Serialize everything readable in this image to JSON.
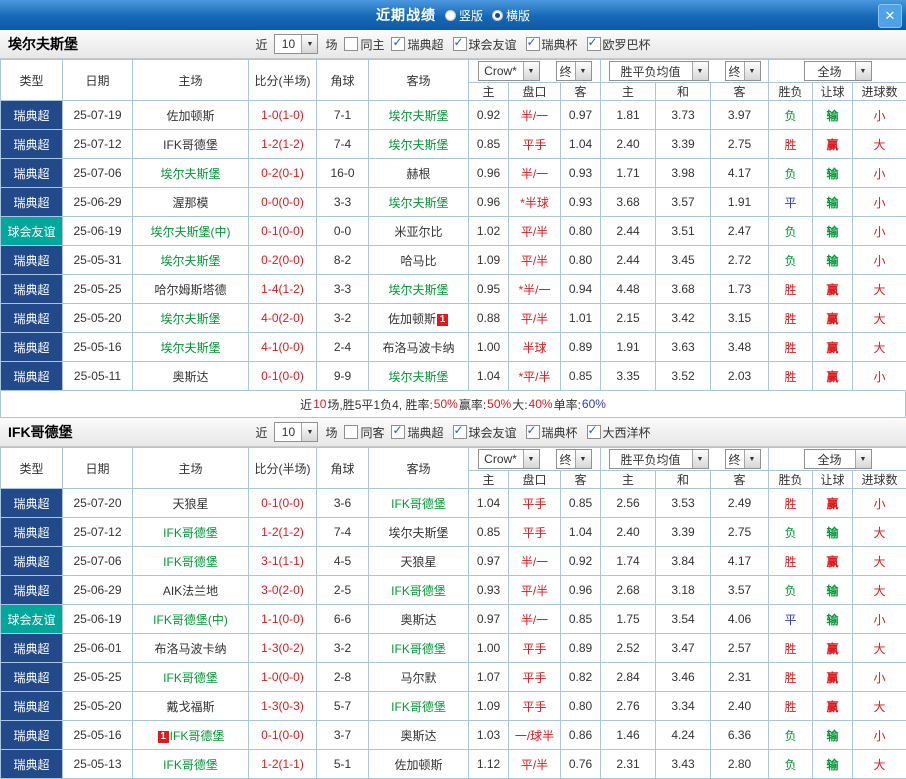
{
  "colors": {
    "red": "#e1191c",
    "green": "#009933",
    "blue": "#2f39c9",
    "navy": "#22498a",
    "teal": "#00a79b"
  },
  "top_bar": {
    "title": "近期战绩",
    "vertical_label": "竖版",
    "horizontal_label": "横版",
    "selected_layout": "横版",
    "close_label": "✕"
  },
  "table_header": {
    "type": "类型",
    "date": "日期",
    "home": "主场",
    "score": "比分(半场)",
    "corner": "角球",
    "away": "客场",
    "sub": [
      "主",
      "盘口",
      "客",
      "主",
      "和",
      "客",
      "胜负",
      "让球",
      "进球数"
    ],
    "dropdown_company": "Crow*",
    "dropdown_final1": "终",
    "dropdown_europe": "胜平负均值",
    "dropdown_final2": "终",
    "dropdown_scope": "全场"
  },
  "sections": [
    {
      "team": "埃尔夫斯堡",
      "filter": {
        "near": "近",
        "count": "10",
        "games": "场",
        "same": "同主",
        "same_checked": false,
        "leagues": [
          {
            "label": "瑞典超",
            "checked": true
          },
          {
            "label": "球会友谊",
            "checked": true
          },
          {
            "label": "瑞典杯",
            "checked": true
          },
          {
            "label": "欧罗巴杯",
            "checked": true
          }
        ]
      },
      "rows": [
        {
          "type": "瑞典超",
          "friendly": false,
          "date": "25-07-19",
          "home": "佐加顿斯",
          "home_focus": false,
          "score": "1-0(1-0)",
          "corner": "7-1",
          "away": "埃尔夫斯堡",
          "away_focus": true,
          "ah_home": "0.92",
          "ah_line": "半/一",
          "ah_away": "0.97",
          "eu_home": "1.81",
          "eu_draw": "3.73",
          "eu_away": "3.97",
          "result": "负",
          "let_ball": "输",
          "goal": "小"
        },
        {
          "type": "瑞典超",
          "friendly": false,
          "date": "25-07-12",
          "home": "IFK哥德堡",
          "home_focus": false,
          "score": "1-2(1-2)",
          "corner": "7-4",
          "away": "埃尔夫斯堡",
          "away_focus": true,
          "ah_home": "0.85",
          "ah_line": "平手",
          "ah_away": "1.04",
          "eu_home": "2.40",
          "eu_draw": "3.39",
          "eu_away": "2.75",
          "result": "胜",
          "let_ball": "赢",
          "goal": "大"
        },
        {
          "type": "瑞典超",
          "friendly": false,
          "date": "25-07-06",
          "home": "埃尔夫斯堡",
          "home_focus": true,
          "score": "0-2(0-1)",
          "corner": "16-0",
          "away": "赫根",
          "away_focus": false,
          "ah_home": "0.96",
          "ah_line": "半/一",
          "ah_away": "0.93",
          "eu_home": "1.71",
          "eu_draw": "3.98",
          "eu_away": "4.17",
          "result": "负",
          "let_ball": "输",
          "goal": "小"
        },
        {
          "type": "瑞典超",
          "friendly": false,
          "date": "25-06-29",
          "home": "渥那模",
          "home_focus": false,
          "score": "0-0(0-0)",
          "corner": "3-3",
          "away": "埃尔夫斯堡",
          "away_focus": true,
          "ah_home": "0.96",
          "ah_line": "*半球",
          "ah_away": "0.93",
          "eu_home": "3.68",
          "eu_draw": "3.57",
          "eu_away": "1.91",
          "result": "平",
          "let_ball": "输",
          "goal": "小"
        },
        {
          "type": "球会友谊",
          "friendly": true,
          "date": "25-06-19",
          "home": "埃尔夫斯堡(中)",
          "home_focus": true,
          "score": "0-1(0-0)",
          "corner": "0-0",
          "away": "米亚尔比",
          "away_focus": false,
          "ah_home": "1.02",
          "ah_line": "平/半",
          "ah_away": "0.80",
          "eu_home": "2.44",
          "eu_draw": "3.51",
          "eu_away": "2.47",
          "result": "负",
          "let_ball": "输",
          "goal": "小"
        },
        {
          "type": "瑞典超",
          "friendly": false,
          "date": "25-05-31",
          "home": "埃尔夫斯堡",
          "home_focus": true,
          "score": "0-2(0-0)",
          "corner": "8-2",
          "away": "哈马比",
          "away_focus": false,
          "ah_home": "1.09",
          "ah_line": "平/半",
          "ah_away": "0.80",
          "eu_home": "2.44",
          "eu_draw": "3.45",
          "eu_away": "2.72",
          "result": "负",
          "let_ball": "输",
          "goal": "小"
        },
        {
          "type": "瑞典超",
          "friendly": false,
          "date": "25-05-25",
          "home": "哈尔姆斯塔德",
          "home_focus": false,
          "score": "1-4(1-2)",
          "corner": "3-3",
          "away": "埃尔夫斯堡",
          "away_focus": true,
          "ah_home": "0.95",
          "ah_line": "*半/一",
          "ah_away": "0.94",
          "eu_home": "4.48",
          "eu_draw": "3.68",
          "eu_away": "1.73",
          "result": "胜",
          "let_ball": "赢",
          "goal": "大"
        },
        {
          "type": "瑞典超",
          "friendly": false,
          "date": "25-05-20",
          "home": "埃尔夫斯堡",
          "home_focus": true,
          "score": "4-0(2-0)",
          "corner": "3-2",
          "away": "佐加顿斯",
          "away_focus": false,
          "away_card": "1",
          "ah_home": "0.88",
          "ah_line": "平/半",
          "ah_away": "1.01",
          "eu_home": "2.15",
          "eu_draw": "3.42",
          "eu_away": "3.15",
          "result": "胜",
          "let_ball": "赢",
          "goal": "大"
        },
        {
          "type": "瑞典超",
          "friendly": false,
          "date": "25-05-16",
          "home": "埃尔夫斯堡",
          "home_focus": true,
          "score": "4-1(0-0)",
          "corner": "2-4",
          "away": "布洛马波卡纳",
          "away_focus": false,
          "ah_home": "1.00",
          "ah_line": "半球",
          "ah_away": "0.89",
          "eu_home": "1.91",
          "eu_draw": "3.63",
          "eu_away": "3.48",
          "result": "胜",
          "let_ball": "赢",
          "goal": "大"
        },
        {
          "type": "瑞典超",
          "friendly": false,
          "date": "25-05-11",
          "home": "奥斯达",
          "home_focus": false,
          "score": "0-1(0-0)",
          "corner": "9-9",
          "away": "埃尔夫斯堡",
          "away_focus": true,
          "ah_home": "1.04",
          "ah_line": "*平/半",
          "ah_away": "0.85",
          "eu_home": "3.35",
          "eu_draw": "3.52",
          "eu_away": "2.03",
          "result": "胜",
          "let_ball": "赢",
          "goal": "小"
        }
      ],
      "summary": [
        {
          "t": "近"
        },
        {
          "t": "10",
          "c": "red"
        },
        {
          "t": "场,胜5平1负4, 胜率:"
        },
        {
          "t": "50%",
          "c": "red"
        },
        {
          "t": " 赢率:"
        },
        {
          "t": "50%",
          "c": "red"
        },
        {
          "t": " 大:"
        },
        {
          "t": "40%",
          "c": "red"
        },
        {
          "t": " 单率:"
        },
        {
          "t": "60%",
          "c": "blue"
        }
      ]
    },
    {
      "team": "IFK哥德堡",
      "filter": {
        "near": "近",
        "count": "10",
        "games": "场",
        "same": "同客",
        "same_checked": false,
        "leagues": [
          {
            "label": "瑞典超",
            "checked": true
          },
          {
            "label": "球会友谊",
            "checked": true
          },
          {
            "label": "瑞典杯",
            "checked": true
          },
          {
            "label": "大西洋杯",
            "checked": true
          }
        ]
      },
      "rows": [
        {
          "type": "瑞典超",
          "friendly": false,
          "date": "25-07-20",
          "home": "天狼星",
          "home_focus": false,
          "score": "0-1(0-0)",
          "corner": "3-6",
          "away": "IFK哥德堡",
          "away_focus": true,
          "ah_home": "1.04",
          "ah_line": "平手",
          "ah_away": "0.85",
          "eu_home": "2.56",
          "eu_draw": "3.53",
          "eu_away": "2.49",
          "result": "胜",
          "let_ball": "赢",
          "goal": "小"
        },
        {
          "type": "瑞典超",
          "friendly": false,
          "date": "25-07-12",
          "home": "IFK哥德堡",
          "home_focus": true,
          "score": "1-2(1-2)",
          "corner": "7-4",
          "away": "埃尔夫斯堡",
          "away_focus": false,
          "ah_home": "0.85",
          "ah_line": "平手",
          "ah_away": "1.04",
          "eu_home": "2.40",
          "eu_draw": "3.39",
          "eu_away": "2.75",
          "result": "负",
          "let_ball": "输",
          "goal": "大"
        },
        {
          "type": "瑞典超",
          "friendly": false,
          "date": "25-07-06",
          "home": "IFK哥德堡",
          "home_focus": true,
          "score": "3-1(1-1)",
          "corner": "4-5",
          "away": "天狼星",
          "away_focus": false,
          "ah_home": "0.97",
          "ah_line": "半/一",
          "ah_away": "0.92",
          "eu_home": "1.74",
          "eu_draw": "3.84",
          "eu_away": "4.17",
          "result": "胜",
          "let_ball": "赢",
          "goal": "大"
        },
        {
          "type": "瑞典超",
          "friendly": false,
          "date": "25-06-29",
          "home": "AIK法兰地",
          "home_focus": false,
          "score": "3-0(2-0)",
          "corner": "2-5",
          "away": "IFK哥德堡",
          "away_focus": true,
          "ah_home": "0.93",
          "ah_line": "平/半",
          "ah_away": "0.96",
          "eu_home": "2.68",
          "eu_draw": "3.18",
          "eu_away": "3.57",
          "result": "负",
          "let_ball": "输",
          "goal": "大"
        },
        {
          "type": "球会友谊",
          "friendly": true,
          "date": "25-06-19",
          "home": "IFK哥德堡(中)",
          "home_focus": true,
          "score": "1-1(0-0)",
          "corner": "6-6",
          "away": "奥斯达",
          "away_focus": false,
          "ah_home": "0.97",
          "ah_line": "半/一",
          "ah_away": "0.85",
          "eu_home": "1.75",
          "eu_draw": "3.54",
          "eu_away": "4.06",
          "result": "平",
          "let_ball": "输",
          "goal": "小"
        },
        {
          "type": "瑞典超",
          "friendly": false,
          "date": "25-06-01",
          "home": "布洛马波卡纳",
          "home_focus": false,
          "score": "1-3(0-2)",
          "corner": "3-2",
          "away": "IFK哥德堡",
          "away_focus": true,
          "ah_home": "1.00",
          "ah_line": "平手",
          "ah_away": "0.89",
          "eu_home": "2.52",
          "eu_draw": "3.47",
          "eu_away": "2.57",
          "result": "胜",
          "let_ball": "赢",
          "goal": "大"
        },
        {
          "type": "瑞典超",
          "friendly": false,
          "date": "25-05-25",
          "home": "IFK哥德堡",
          "home_focus": true,
          "score": "1-0(0-0)",
          "corner": "2-8",
          "away": "马尔默",
          "away_focus": false,
          "ah_home": "1.07",
          "ah_line": "平手",
          "ah_away": "0.82",
          "eu_home": "2.84",
          "eu_draw": "3.46",
          "eu_away": "2.31",
          "result": "胜",
          "let_ball": "赢",
          "goal": "小"
        },
        {
          "type": "瑞典超",
          "friendly": false,
          "date": "25-05-20",
          "home": "戴戈福斯",
          "home_focus": false,
          "score": "1-3(0-3)",
          "corner": "5-7",
          "away": "IFK哥德堡",
          "away_focus": true,
          "ah_home": "1.09",
          "ah_line": "平手",
          "ah_away": "0.80",
          "eu_home": "2.76",
          "eu_draw": "3.34",
          "eu_away": "2.40",
          "result": "胜",
          "let_ball": "赢",
          "goal": "大"
        },
        {
          "type": "瑞典超",
          "friendly": false,
          "date": "25-05-16",
          "home": "IFK哥德堡",
          "home_focus": true,
          "home_card": "1",
          "score": "0-1(0-0)",
          "corner": "3-7",
          "away": "奥斯达",
          "away_focus": false,
          "ah_home": "1.03",
          "ah_line": "一/球半",
          "ah_away": "0.86",
          "eu_home": "1.46",
          "eu_draw": "4.24",
          "eu_away": "6.36",
          "result": "负",
          "let_ball": "输",
          "goal": "小"
        },
        {
          "type": "瑞典超",
          "friendly": false,
          "date": "25-05-13",
          "home": "IFK哥德堡",
          "home_focus": true,
          "score": "1-2(1-1)",
          "corner": "5-1",
          "away": "佐加顿斯",
          "away_focus": false,
          "ah_home": "1.12",
          "ah_line": "平/半",
          "ah_away": "0.76",
          "eu_home": "2.31",
          "eu_draw": "3.43",
          "eu_away": "2.80",
          "result": "负",
          "let_ball": "输",
          "goal": "大"
        }
      ],
      "summary": []
    }
  ]
}
